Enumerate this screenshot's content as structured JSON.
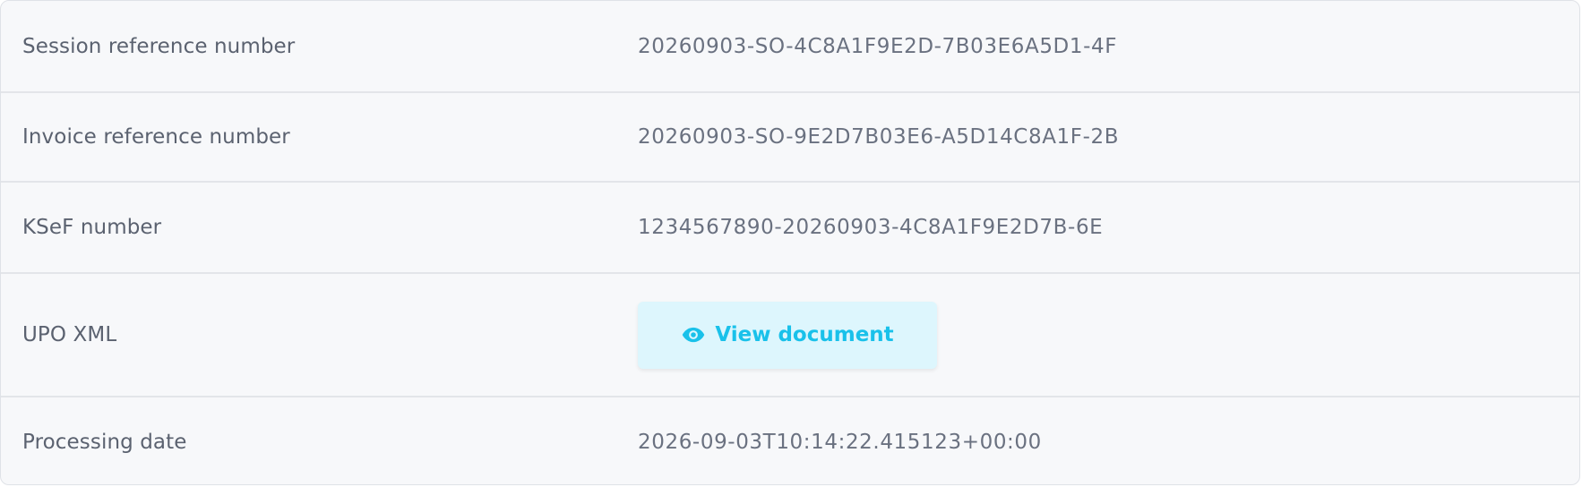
{
  "details": {
    "rows": [
      {
        "label": "Session reference number",
        "value": "20260903-SO-4C8A1F9E2D-7B03E6A5D1-4F"
      },
      {
        "label": "Invoice reference number",
        "value": "20260903-SO-9E2D7B03E6-A5D14C8A1F-2B"
      },
      {
        "label": "KSeF number",
        "value": "1234567890-20260903-4C8A1F9E2D7B-6E"
      },
      {
        "label": "UPO XML",
        "button_label": "View document",
        "button_icon": "eye-icon"
      },
      {
        "label": "Processing date",
        "value": "2026-09-03T10:14:22.415123+00:00"
      }
    ]
  },
  "colors": {
    "panel_background": "#f7f8fa",
    "label_text": "#5b6270",
    "value_text": "#6a7180",
    "button_background": "#ddf6fd",
    "button_text": "#19c1ea"
  }
}
